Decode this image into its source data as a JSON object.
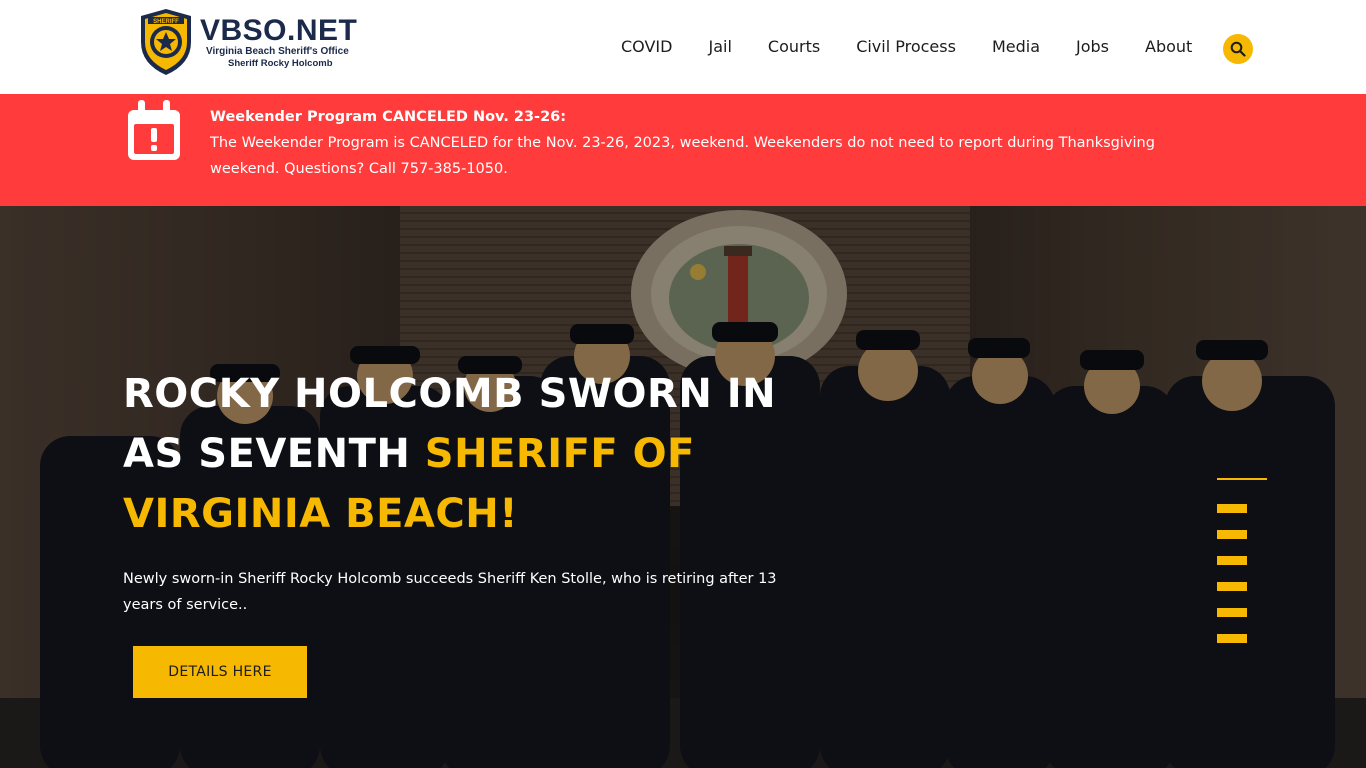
{
  "brand": {
    "title": "VBSO.NET",
    "subtitle": "Virginia Beach Sheriff's Office",
    "tagline": "Sheriff Rocky Holcomb",
    "badge_text": "SHERIFF",
    "accent": "#f6b800",
    "navy": "#1b2a4a"
  },
  "nav": {
    "items": [
      {
        "label": "COVID"
      },
      {
        "label": "Jail"
      },
      {
        "label": "Courts"
      },
      {
        "label": "Civil Process"
      },
      {
        "label": "Media"
      },
      {
        "label": "Jobs"
      },
      {
        "label": "About"
      }
    ],
    "search_icon": "search-icon"
  },
  "alert": {
    "color": "#ff3b3b",
    "icon": "calendar-alert-icon",
    "title": "Weekender Program CANCELED Nov. 23-26:",
    "body": "The Weekender Program is CANCELED for the Nov. 23-26, 2023, weekend. Weekenders do not need to report during Thanksgiving weekend. Questions? Call 757-385-1050."
  },
  "hero": {
    "title_white": "ROCKY HOLCOMB SWORN IN AS SEVENTH ",
    "title_highlight": "SHERIFF OF VIRGINIA BEACH!",
    "description": "Newly sworn-in Sheriff Rocky Holcomb succeeds Sheriff Ken Stolle, who is retiring after 13 years of service..",
    "cta_label": "DETAILS HERE",
    "slides_count": 6
  }
}
